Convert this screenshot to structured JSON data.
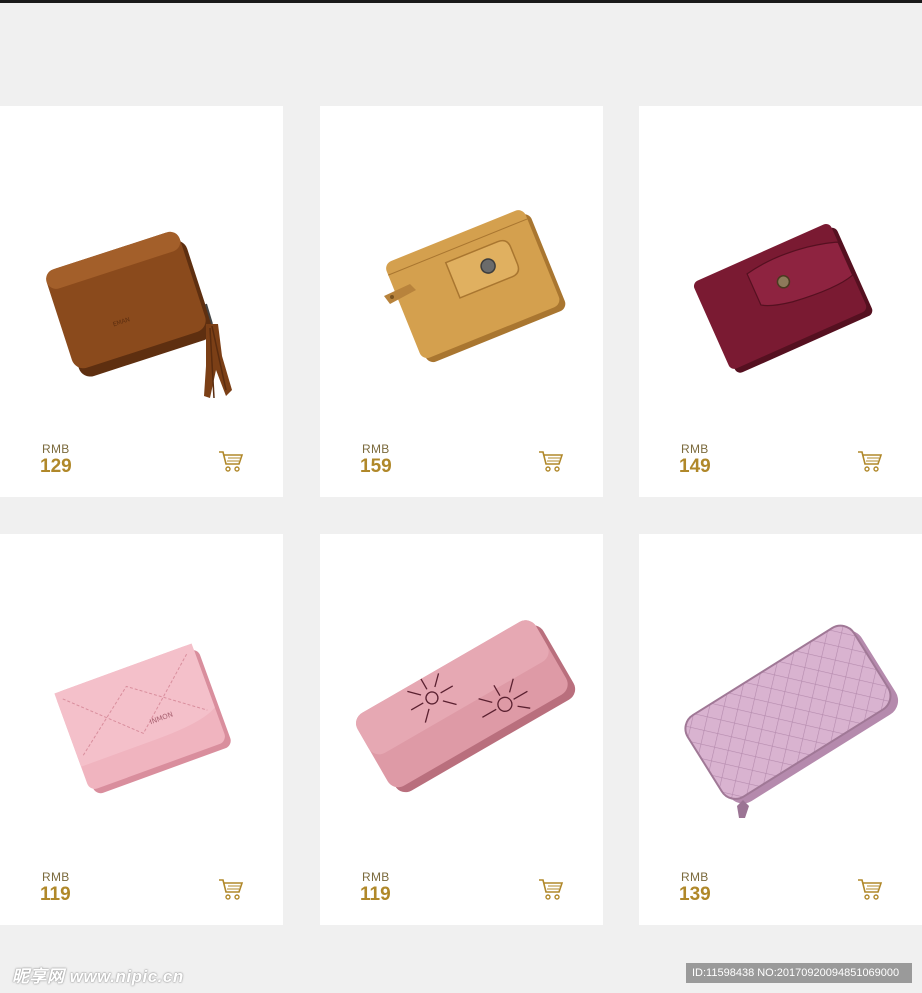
{
  "products": [
    {
      "currency": "RMB",
      "price": "129",
      "image": "brown-tassel-wallet",
      "colors": {
        "body": "#8a4a1c",
        "dark": "#5e2f10",
        "light": "#b2703a"
      }
    },
    {
      "currency": "RMB",
      "price": "159",
      "image": "tan-snap-wallet",
      "colors": {
        "body": "#d4a04e",
        "dark": "#a97630",
        "light": "#e8bf74"
      }
    },
    {
      "currency": "RMB",
      "price": "149",
      "image": "burgundy-button-wallet",
      "colors": {
        "body": "#7a1a32",
        "dark": "#551020",
        "light": "#9a2a48"
      }
    },
    {
      "currency": "RMB",
      "price": "119",
      "image": "pink-stitched-wallet",
      "colors": {
        "body": "#f0b4bf",
        "dark": "#d98e9d",
        "light": "#f8cdd5"
      }
    },
    {
      "currency": "RMB",
      "price": "119",
      "image": "pink-laser-cut-long-wallet",
      "colors": {
        "body": "#de9aa6",
        "dark": "#b96f7d",
        "light": "#ecb6c0"
      }
    },
    {
      "currency": "RMB",
      "price": "139",
      "image": "lilac-quilted-zip-wallet",
      "colors": {
        "body": "#d9b3d0",
        "dark": "#b58aad",
        "light": "#ecd2e6"
      }
    }
  ],
  "cart_icon": "shopping-cart-icon",
  "accent_color": "#b0882a",
  "watermark": {
    "site": "昵享网 www.nipic.cn",
    "id_text": "ID:11598438 NO:20170920094851069000"
  }
}
